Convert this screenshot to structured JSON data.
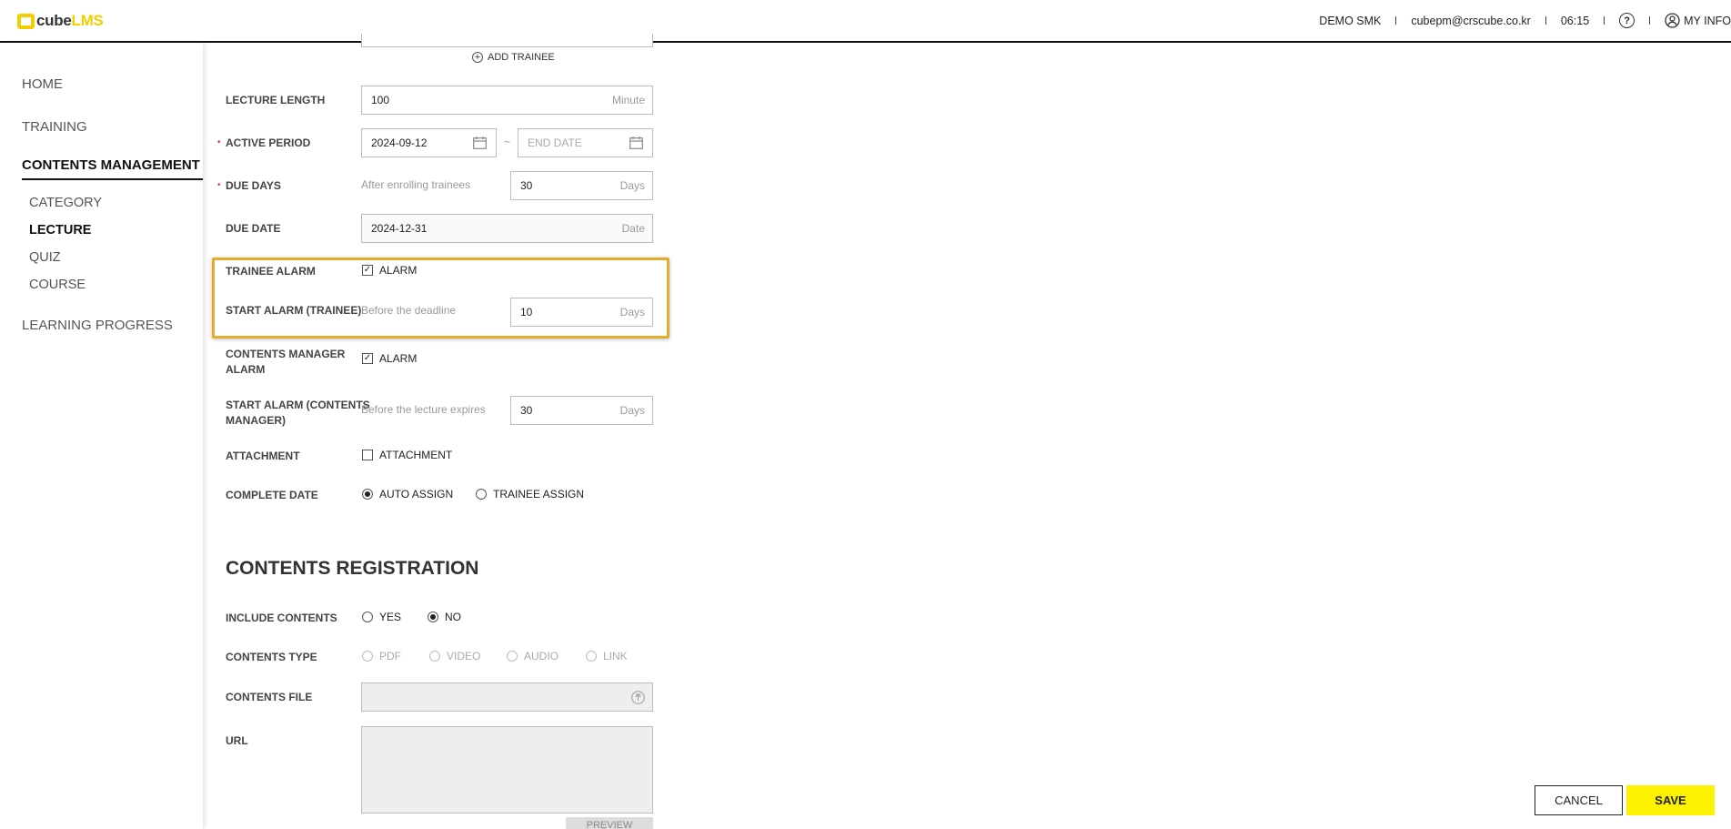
{
  "header": {
    "logo_cube": "cube",
    "logo_lms": "LMS",
    "org": "DEMO SMK",
    "email": "cubepm@crscube.co.kr",
    "time": "06:15",
    "help_glyph": "?",
    "my_info": "MY INFO"
  },
  "sidebar": {
    "home": "HOME",
    "training": "TRAINING",
    "contents_management": "CONTENTS MANAGEMENT",
    "sub": [
      "CATEGORY",
      "LECTURE",
      "QUIZ",
      "COURSE"
    ],
    "learning_progress": "LEARNING PROGRESS"
  },
  "form": {
    "add_trainee": "ADD TRAINEE",
    "lecture_length": {
      "label": "LECTURE LENGTH",
      "value": "100",
      "unit": "Minute"
    },
    "active_period": {
      "label": "ACTIVE PERIOD",
      "start": "2024-09-12",
      "separator": "~",
      "end_placeholder": "END DATE"
    },
    "due_days": {
      "label": "DUE DAYS",
      "hint": "After enrolling trainees",
      "value": "30",
      "unit": "Days"
    },
    "due_date": {
      "label": "DUE DATE",
      "value": "2024-12-31",
      "unit": "Date"
    },
    "trainee_alarm": {
      "label": "TRAINEE ALARM",
      "checkbox": "ALARM",
      "checked": true
    },
    "start_alarm_trainee": {
      "label": "START ALARM (TRAINEE)",
      "hint": "Before the deadline",
      "value": "10",
      "unit": "Days"
    },
    "contents_manager_alarm": {
      "label_line1": "CONTENTS MANAGER",
      "label_line2": "ALARM",
      "checkbox": "ALARM",
      "checked": true
    },
    "start_alarm_cm": {
      "label_line1": "START ALARM (CONTENTS",
      "label_line2": "MANAGER)",
      "hint": "Before the lecture expires",
      "value": "30",
      "unit": "Days"
    },
    "attachment": {
      "label": "ATTACHMENT",
      "checkbox": "ATTACHMENT",
      "checked": false
    },
    "complete_date": {
      "label": "COMPLETE DATE",
      "options": [
        "AUTO ASSIGN",
        "TRAINEE ASSIGN"
      ],
      "selected": "AUTO ASSIGN"
    }
  },
  "registration": {
    "title": "CONTENTS REGISTRATION",
    "include_contents": {
      "label": "INCLUDE CONTENTS",
      "options": [
        "YES",
        "NO"
      ],
      "selected": "NO"
    },
    "contents_type": {
      "label": "CONTENTS TYPE",
      "options": [
        "PDF",
        "VIDEO",
        "AUDIO",
        "LINK"
      ]
    },
    "contents_file": {
      "label": "CONTENTS FILE"
    },
    "url": {
      "label": "URL"
    },
    "preview": "PREVIEW"
  },
  "actions": {
    "cancel": "CANCEL",
    "save": "SAVE"
  },
  "colors": {
    "brand_yellow": "#f2cf00",
    "save_yellow": "#fff200",
    "highlight": "#e5ad30",
    "required": "#e33333"
  },
  "icons": [
    "calendar-icon",
    "help-icon",
    "user-icon",
    "add-circle-icon",
    "upload-icon",
    "checkbox-icon"
  ]
}
